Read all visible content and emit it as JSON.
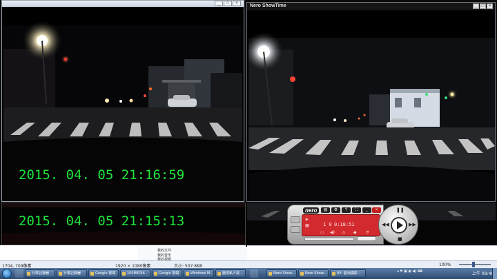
{
  "left_window": {
    "timestamp_main": "2015. 04. 05  21:16:59",
    "timestamp_lower": "2015. 04. 05  21:15:13"
  },
  "right_window": {
    "title": "Nero ShowTime"
  },
  "nero_player": {
    "logo": "nero",
    "track_index": "1  0",
    "time": "0:18:51"
  },
  "explorer": {
    "mid_items": [
      "我的文件",
      "我的音乐",
      "我的视频"
    ]
  },
  "status_bar": {
    "position": "1704, 709像素",
    "dimensions": "1920 × 1080像素",
    "size": "大小: 507.8KB",
    "zoom": "100%"
  },
  "taskbar": {
    "items": [
      {
        "label": "行車記錄器"
      },
      {
        "label": "行車記錄器"
      },
      {
        "label": "Google 雲端"
      },
      {
        "label": "100MEDIA"
      },
      {
        "label": "Google 雲端"
      },
      {
        "label": "Windows M..."
      },
      {
        "label": "變成私人資..."
      },
      {
        "label": "Nero Show..."
      },
      {
        "label": "Nero Show..."
      },
      {
        "label": "RE: 歐洲攝影..."
      }
    ],
    "clock": "上午 09:48"
  }
}
